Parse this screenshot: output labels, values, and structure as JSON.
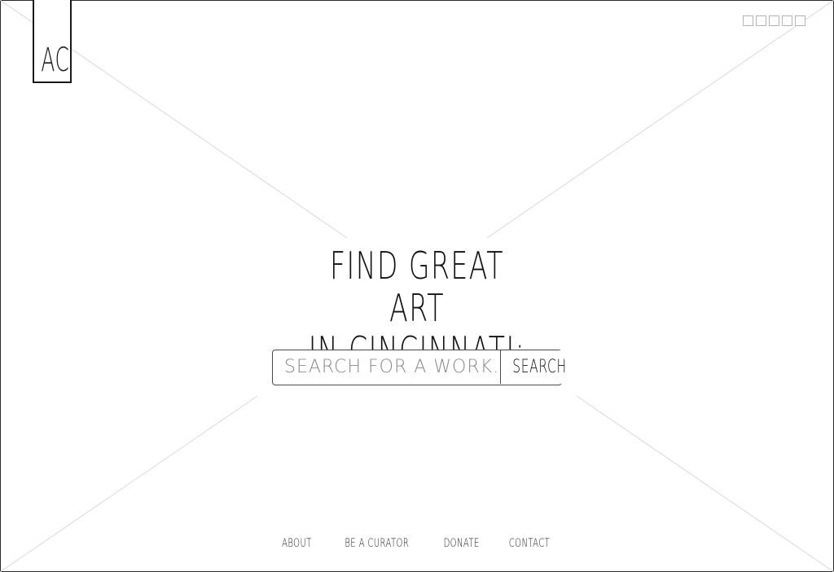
{
  "logo": {
    "text": "AC"
  },
  "window_controls": {
    "count": 5
  },
  "hero": {
    "line1": "FIND GREAT ART",
    "line2": "IN CINCINNATI:"
  },
  "search": {
    "placeholder": "SEARCH FOR A WORK...",
    "value": "",
    "button_label": "SEARCH"
  },
  "footer": {
    "links": [
      {
        "label": "ABOUT"
      },
      {
        "label": "BE A CURATOR"
      },
      {
        "label": "DONATE"
      },
      {
        "label": "CONTACT"
      }
    ]
  },
  "colors": {
    "line": "#1a1a1a",
    "placeholder_box": "#d9d9d9",
    "background": "#ffffff"
  }
}
